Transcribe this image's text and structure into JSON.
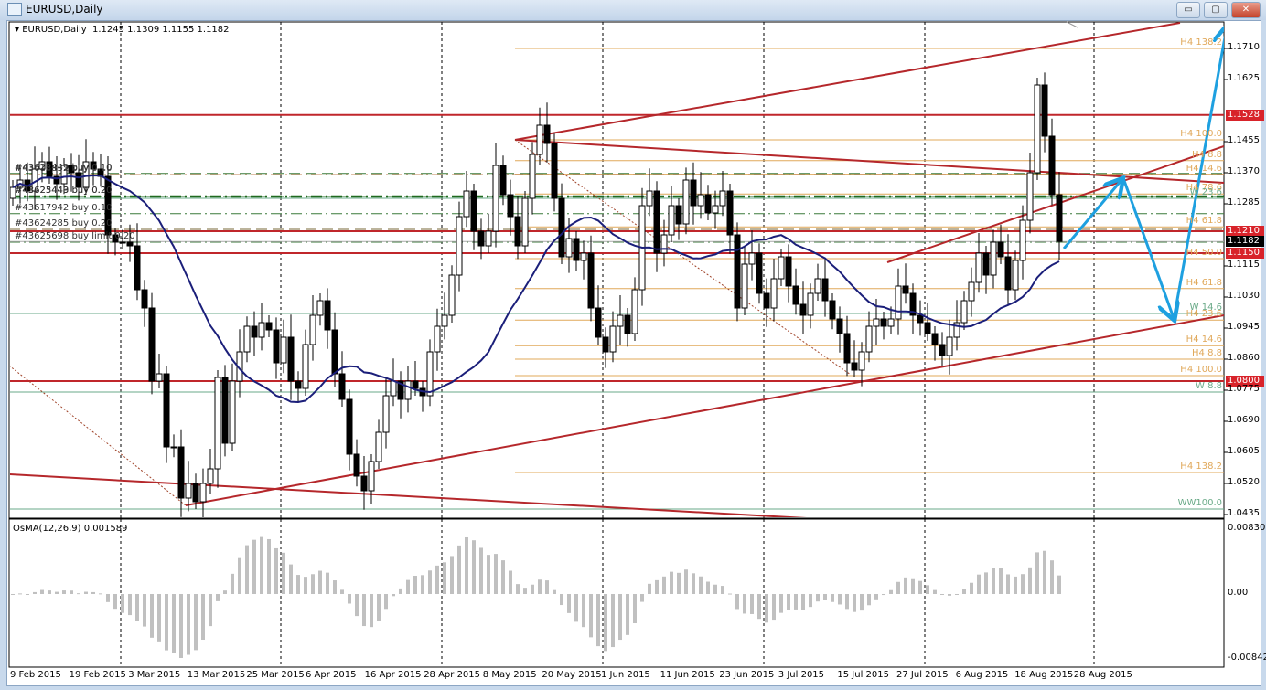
{
  "window": {
    "title": "EURUSD,Daily",
    "minimize_label": "▭",
    "restore_label": "▢",
    "close_label": "✕"
  },
  "header": {
    "symbol": "EURUSD,Daily",
    "ohlc": "1.1245 1.1309 1.1155 1.1182"
  },
  "orders": [
    {
      "label": "#43618832 buy 0.10",
      "price": 1.1365
    },
    {
      "label": "#43622449 buy 0.10",
      "price": 1.1368
    },
    {
      "label": "#43625449 buy 0.20",
      "price": 1.1305
    },
    {
      "label": "#43623443 buy 0.20",
      "price": 1.1305
    },
    {
      "label": "#43617942 buy 0.10",
      "price": 1.1258
    },
    {
      "label": "#43624285 buy 0.20",
      "price": 1.1215
    },
    {
      "label": "#43625698 buy limit 0.20",
      "price": 1.118
    }
  ],
  "levels": [
    {
      "label": "H4 138.2",
      "price": 1.171,
      "color": "#e0a85a",
      "full": false
    },
    {
      "label": "H4 100.0",
      "price": 1.146,
      "color": "#e0a85a",
      "full": false
    },
    {
      "label": "H4 8.8",
      "price": 1.1403,
      "color": "#e0a85a",
      "full": false
    },
    {
      "label": "H4 14.6",
      "price": 1.1366,
      "color": "#e0a85a",
      "full": false
    },
    {
      "label": "H4 78.6",
      "price": 1.1312,
      "color": "#e0a85a",
      "full": false
    },
    {
      "label": "W 23.6",
      "price": 1.13,
      "color": "#6aaa88",
      "full": true
    },
    {
      "label": "H4 61.8",
      "price": 1.1222,
      "color": "#e0a85a",
      "full": false
    },
    {
      "label": "H4 50.0",
      "price": 1.1135,
      "color": "#e0a85a",
      "full": false
    },
    {
      "label": "H4 61.8",
      "price": 1.1053,
      "color": "#e0a85a",
      "full": false
    },
    {
      "label": "W 14.6",
      "price": 1.0985,
      "color": "#6aaa88",
      "full": true
    },
    {
      "label": "H4 23.6",
      "price": 1.0967,
      "color": "#e0a85a",
      "full": false
    },
    {
      "label": "H4 14.6",
      "price": 1.0897,
      "color": "#e0a85a",
      "full": false
    },
    {
      "label": "H4 8.8",
      "price": 1.086,
      "color": "#e0a85a",
      "full": false
    },
    {
      "label": "H4 100.0",
      "price": 1.0815,
      "color": "#e0a85a",
      "full": false
    },
    {
      "label": "W 8.8",
      "price": 1.077,
      "color": "#6aaa88",
      "full": true
    },
    {
      "label": "H4 138.2",
      "price": 1.055,
      "color": "#e0a85a",
      "full": false
    },
    {
      "label": "WW100.0",
      "price": 1.045,
      "color": "#6aaa88",
      "full": true
    }
  ],
  "sr_levels": [
    {
      "price": 1.1528,
      "label": "1.1528"
    },
    {
      "price": 1.121,
      "label": "1.1210"
    },
    {
      "price": 1.115,
      "label": "1.1150"
    },
    {
      "price": 1.08,
      "label": "1.0800"
    }
  ],
  "current_price": {
    "price": 1.1182,
    "label": "1.1182"
  },
  "colors": {
    "sr": "#c0262b",
    "trend": "#b5272b",
    "ma": "#1b1f7a",
    "arrow": "#1ea0e0",
    "osma": "#c0c0c0"
  },
  "price_axis": [
    "1.1710",
    "1.1625",
    "1.1455",
    "1.1370",
    "1.1285",
    "1.1115",
    "1.1030",
    "1.0945",
    "1.0860",
    "1.0775",
    "1.0690",
    "1.0605",
    "1.0520",
    "1.0435"
  ],
  "indicator": {
    "label": "OsMA(12,26,9) 0.001589",
    "max_label": "0.008307",
    "zero_label": "0.00",
    "min_label": "-0.00842"
  },
  "chart_data": {
    "type": "candlestick",
    "title": "EURUSD,Daily",
    "ylim": [
      1.0435,
      1.171
    ],
    "x_tick_labels": [
      "9 Feb 2015",
      "19 Feb 2015",
      "3 Mar 2015",
      "13 Mar 2015",
      "25 Mar 2015",
      "6 Apr 2015",
      "16 Apr 2015",
      "28 Apr 2015",
      "8 May 2015",
      "20 May 2015",
      "1 Jun 2015",
      "11 Jun 2015",
      "23 Jun 2015",
      "3 Jul 2015",
      "15 Jul 2015",
      "27 Jul 2015",
      "6 Aug 2015",
      "18 Aug 2015",
      "28 Aug 2015"
    ],
    "closes": [
      1.133,
      1.135,
      1.132,
      1.138,
      1.14,
      1.136,
      1.134,
      1.139,
      1.137,
      1.133,
      1.14,
      1.138,
      1.136,
      1.12,
      1.118,
      1.118,
      1.117,
      1.105,
      1.1,
      1.08,
      1.082,
      1.062,
      1.062,
      1.048,
      1.052,
      1.047,
      1.052,
      1.056,
      1.081,
      1.063,
      1.08,
      1.088,
      1.095,
      1.092,
      1.096,
      1.094,
      1.085,
      1.092,
      1.08,
      1.078,
      1.09,
      1.098,
      1.102,
      1.094,
      1.082,
      1.075,
      1.06,
      1.054,
      1.05,
      1.058,
      1.066,
      1.076,
      1.08,
      1.075,
      1.08,
      1.078,
      1.076,
      1.088,
      1.095,
      1.098,
      1.109,
      1.125,
      1.132,
      1.121,
      1.117,
      1.121,
      1.139,
      1.131,
      1.125,
      1.117,
      1.13,
      1.142,
      1.15,
      1.145,
      1.13,
      1.114,
      1.119,
      1.113,
      1.115,
      1.1,
      1.092,
      1.088,
      1.095,
      1.098,
      1.093,
      1.105,
      1.128,
      1.132,
      1.115,
      1.12,
      1.128,
      1.123,
      1.135,
      1.128,
      1.131,
      1.126,
      1.128,
      1.132,
      1.12,
      1.1,
      1.112,
      1.115,
      1.104,
      1.1,
      1.108,
      1.114,
      1.106,
      1.101,
      1.098,
      1.104,
      1.108,
      1.102,
      1.097,
      1.093,
      1.085,
      1.083,
      1.088,
      1.095,
      1.097,
      1.095,
      1.097,
      1.106,
      1.104,
      1.098,
      1.096,
      1.093,
      1.09,
      1.087,
      1.092,
      1.096,
      1.102,
      1.107,
      1.115,
      1.109,
      1.118,
      1.114,
      1.105,
      1.113,
      1.124,
      1.137,
      1.161,
      1.147,
      1.131,
      1.1182
    ],
    "first_open": 1.13,
    "ma_period": 20,
    "osma_params": [
      12,
      26,
      9
    ]
  }
}
